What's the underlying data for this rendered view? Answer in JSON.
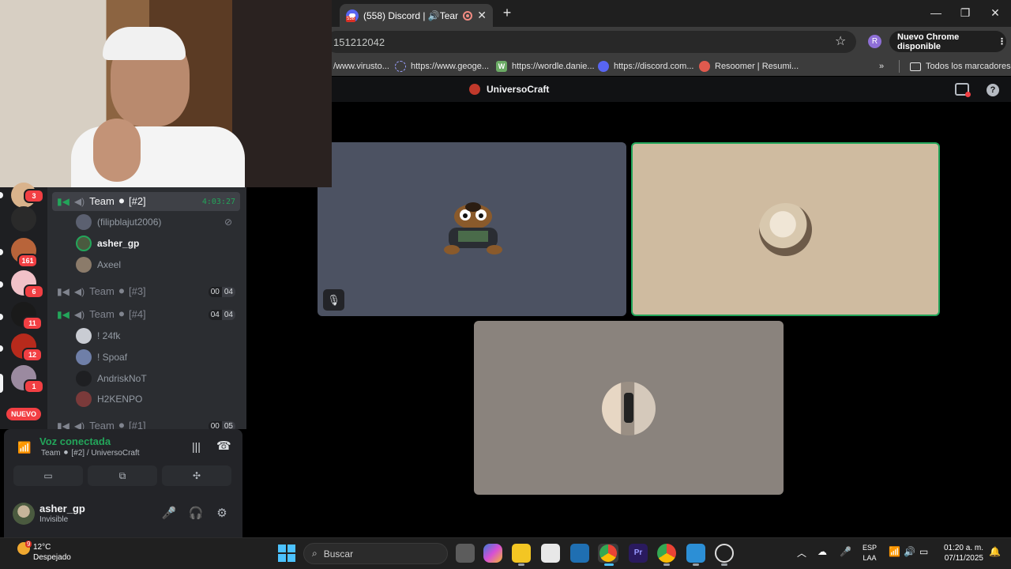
{
  "browser": {
    "tab_title": "(558) Discord | 🔊Team",
    "tab_badge": "558",
    "url_fragment": "151212042",
    "update_button": "Nuevo Chrome disponible",
    "profile_initial": "R",
    "bookmarks": [
      {
        "label": "/www.virusto...",
        "color": "#3c3c3c"
      },
      {
        "label": "https://www.geoge...",
        "color": "#6b5bd2"
      },
      {
        "label": "https://wordle.danie...",
        "color": "#6aaa64"
      },
      {
        "label": "https://discord.com...",
        "color": "#5865f2"
      },
      {
        "label": "Resoomer | Resumi...",
        "color": "#e05a4e"
      }
    ],
    "all_bookmarks": "Todos los marcadores"
  },
  "discord": {
    "server_name": "UniversoCraft",
    "guilds": [
      {
        "badge": "3",
        "color": "#d9b38c"
      },
      {
        "badge": "",
        "color": "#2a2a2a"
      },
      {
        "badge": "161",
        "color": "#b8643a"
      },
      {
        "badge": "6",
        "color": "#f1c1c8"
      },
      {
        "badge": "11",
        "color": "#1a1a1a"
      },
      {
        "badge": "12",
        "color": "#b72a1c"
      },
      {
        "badge": "1",
        "color": "#9b8aa0"
      }
    ],
    "nuevo_label": "NUEVO",
    "channels": {
      "team2": {
        "name": "Team ⚫ [#2]",
        "time": "4:03:27"
      },
      "team2_members": [
        "(filipblajut2006)",
        "asher_gp",
        "Axeel"
      ],
      "team3": {
        "name": "Team ⚫ [#3]",
        "count": "00",
        "limit": "04"
      },
      "team4": {
        "name": "Team ⚫ [#4]",
        "count": "04",
        "limit": "04"
      },
      "team4_members": [
        "! 24fk",
        "! Spoaf",
        "AndriskNoT",
        "H2KENPO"
      ],
      "team1": {
        "name": "Team ⚫ [#1]",
        "count": "00",
        "limit": "05"
      }
    },
    "voice": {
      "status": "Voz conectada",
      "location": "Team ⚫ [#2] / UniversoCraft"
    },
    "user": {
      "name": "asher_gp",
      "status": "Invisible"
    }
  },
  "taskbar": {
    "weather_badge": "9",
    "temperature": "12°C",
    "weather": "Despejado",
    "search_placeholder": "Buscar",
    "lang_top": "ESP",
    "lang_bottom": "LAA",
    "time": "01:20 a. m.",
    "date": "07/11/2025"
  }
}
